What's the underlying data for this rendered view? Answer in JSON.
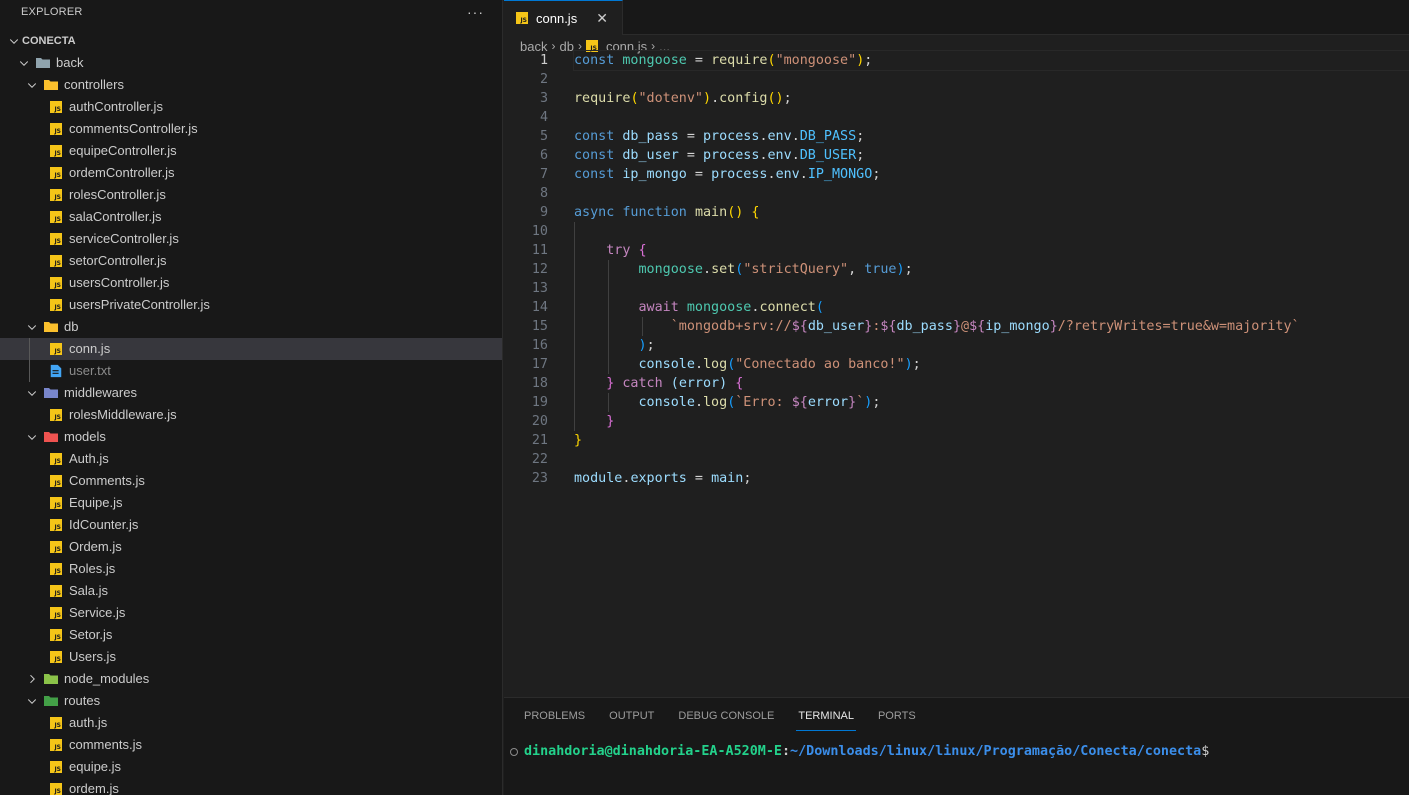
{
  "explorer": {
    "title": "EXPLORER",
    "more_label": "···",
    "root": "CONECTA",
    "tree": [
      {
        "name": "back",
        "type": "folder",
        "depth": 0,
        "expanded": true,
        "icon": "folder-icon",
        "color": "#90a4ae"
      },
      {
        "name": "controllers",
        "type": "folder",
        "depth": 1,
        "expanded": true,
        "icon": "folder-controllers-icon",
        "color": "#fbc02d"
      },
      {
        "name": "authController.js",
        "type": "js",
        "depth": 2
      },
      {
        "name": "commentsController.js",
        "type": "js",
        "depth": 2
      },
      {
        "name": "equipeController.js",
        "type": "js",
        "depth": 2
      },
      {
        "name": "ordemController.js",
        "type": "js",
        "depth": 2
      },
      {
        "name": "rolesController.js",
        "type": "js",
        "depth": 2
      },
      {
        "name": "salaController.js",
        "type": "js",
        "depth": 2
      },
      {
        "name": "serviceController.js",
        "type": "js",
        "depth": 2
      },
      {
        "name": "setorController.js",
        "type": "js",
        "depth": 2
      },
      {
        "name": "usersController.js",
        "type": "js",
        "depth": 2
      },
      {
        "name": "usersPrivateController.js",
        "type": "js",
        "depth": 2
      },
      {
        "name": "db",
        "type": "folder",
        "depth": 1,
        "expanded": true,
        "icon": "folder-database-icon",
        "color": "#fbc02d"
      },
      {
        "name": "conn.js",
        "type": "js",
        "depth": 2,
        "selected": true
      },
      {
        "name": "user.txt",
        "type": "txt",
        "depth": 2,
        "dim": true
      },
      {
        "name": "middlewares",
        "type": "folder",
        "depth": 1,
        "expanded": true,
        "icon": "folder-middleware-icon",
        "color": "#7986cb"
      },
      {
        "name": "rolesMiddleware.js",
        "type": "js",
        "depth": 2
      },
      {
        "name": "models",
        "type": "folder",
        "depth": 1,
        "expanded": true,
        "icon": "folder-models-icon",
        "color": "#ef5350"
      },
      {
        "name": "Auth.js",
        "type": "js",
        "depth": 2
      },
      {
        "name": "Comments.js",
        "type": "js",
        "depth": 2
      },
      {
        "name": "Equipe.js",
        "type": "js",
        "depth": 2
      },
      {
        "name": "IdCounter.js",
        "type": "js",
        "depth": 2
      },
      {
        "name": "Ordem.js",
        "type": "js",
        "depth": 2
      },
      {
        "name": "Roles.js",
        "type": "js",
        "depth": 2
      },
      {
        "name": "Sala.js",
        "type": "js",
        "depth": 2
      },
      {
        "name": "Service.js",
        "type": "js",
        "depth": 2
      },
      {
        "name": "Setor.js",
        "type": "js",
        "depth": 2
      },
      {
        "name": "Users.js",
        "type": "js",
        "depth": 2
      },
      {
        "name": "node_modules",
        "type": "folder",
        "depth": 1,
        "expanded": false,
        "icon": "folder-node-icon",
        "color": "#8bc34a"
      },
      {
        "name": "routes",
        "type": "folder",
        "depth": 1,
        "expanded": true,
        "icon": "folder-routes-icon",
        "color": "#43a047"
      },
      {
        "name": "auth.js",
        "type": "js",
        "depth": 2
      },
      {
        "name": "comments.js",
        "type": "js",
        "depth": 2
      },
      {
        "name": "equipe.js",
        "type": "js",
        "depth": 2
      },
      {
        "name": "ordem.js",
        "type": "js",
        "depth": 2
      }
    ]
  },
  "editor": {
    "tab": {
      "label": "conn.js",
      "close": "✕",
      "icon_text": "JS"
    },
    "breadcrumb": [
      "back",
      "db",
      "conn.js",
      "..."
    ],
    "active_line": 1,
    "lines": [
      [
        [
          "k",
          "const "
        ],
        [
          "v",
          "mongoose"
        ],
        [
          "o",
          " = "
        ],
        [
          "f",
          "require"
        ],
        [
          "p1",
          "("
        ],
        [
          "s",
          "\"mongoose\""
        ],
        [
          "p1",
          ")"
        ],
        [
          "o",
          ";"
        ]
      ],
      [],
      [
        [
          "f",
          "require"
        ],
        [
          "p1",
          "("
        ],
        [
          "s",
          "\"dotenv\""
        ],
        [
          "p1",
          ")"
        ],
        [
          "o",
          "."
        ],
        [
          "f",
          "config"
        ],
        [
          "p1",
          "()"
        ],
        [
          "o",
          ";"
        ]
      ],
      [],
      [
        [
          "k",
          "const "
        ],
        [
          "vb",
          "db_pass"
        ],
        [
          "o",
          " = "
        ],
        [
          "vb",
          "process"
        ],
        [
          "o",
          "."
        ],
        [
          "vb",
          "env"
        ],
        [
          "o",
          "."
        ],
        [
          "c",
          "DB_PASS"
        ],
        [
          "o",
          ";"
        ]
      ],
      [
        [
          "k",
          "const "
        ],
        [
          "vb",
          "db_user"
        ],
        [
          "o",
          " = "
        ],
        [
          "vb",
          "process"
        ],
        [
          "o",
          "."
        ],
        [
          "vb",
          "env"
        ],
        [
          "o",
          "."
        ],
        [
          "c",
          "DB_USER"
        ],
        [
          "o",
          ";"
        ]
      ],
      [
        [
          "k",
          "const "
        ],
        [
          "vb",
          "ip_mongo"
        ],
        [
          "o",
          " = "
        ],
        [
          "vb",
          "process"
        ],
        [
          "o",
          "."
        ],
        [
          "vb",
          "env"
        ],
        [
          "o",
          "."
        ],
        [
          "c",
          "IP_MONGO"
        ],
        [
          "o",
          ";"
        ]
      ],
      [],
      [
        [
          "k",
          "async "
        ],
        [
          "k",
          "function "
        ],
        [
          "f",
          "main"
        ],
        [
          "p1",
          "()"
        ],
        [
          "o",
          " "
        ],
        [
          "p1",
          "{"
        ]
      ],
      [],
      [
        [
          "o",
          "    "
        ],
        [
          "kc",
          "try "
        ],
        [
          "p2",
          "{"
        ]
      ],
      [
        [
          "o",
          "        "
        ],
        [
          "v",
          "mongoose"
        ],
        [
          "o",
          "."
        ],
        [
          "f",
          "set"
        ],
        [
          "p3",
          "("
        ],
        [
          "s",
          "\"strictQuery\""
        ],
        [
          "o",
          ", "
        ],
        [
          "k",
          "true"
        ],
        [
          "p3",
          ")"
        ],
        [
          "o",
          ";"
        ]
      ],
      [],
      [
        [
          "o",
          "        "
        ],
        [
          "kc",
          "await "
        ],
        [
          "v",
          "mongoose"
        ],
        [
          "o",
          "."
        ],
        [
          "f",
          "connect"
        ],
        [
          "p3",
          "("
        ]
      ],
      [
        [
          "o",
          "            "
        ],
        [
          "s",
          "`mongodb+srv://"
        ],
        [
          "kc",
          "${"
        ],
        [
          "vb",
          "db_user"
        ],
        [
          "kc",
          "}"
        ],
        [
          "s",
          ":"
        ],
        [
          "kc",
          "${"
        ],
        [
          "vb",
          "db_pass"
        ],
        [
          "kc",
          "}"
        ],
        [
          "s",
          "@"
        ],
        [
          "kc",
          "${"
        ],
        [
          "vb",
          "ip_mongo"
        ],
        [
          "kc",
          "}"
        ],
        [
          "s",
          "/?retryWrites=true&w=majority`"
        ]
      ],
      [
        [
          "o",
          "        "
        ],
        [
          "p3",
          ")"
        ],
        [
          "o",
          ";"
        ]
      ],
      [
        [
          "o",
          "        "
        ],
        [
          "vb",
          "console"
        ],
        [
          "o",
          "."
        ],
        [
          "f",
          "log"
        ],
        [
          "p3",
          "("
        ],
        [
          "s",
          "\"Conectado ao banco!\""
        ],
        [
          "p3",
          ")"
        ],
        [
          "o",
          ";"
        ]
      ],
      [
        [
          "o",
          "    "
        ],
        [
          "p2",
          "}"
        ],
        [
          "kc",
          " catch "
        ],
        [
          "vb",
          "("
        ],
        [
          "vb",
          "error"
        ],
        [
          "vb",
          ")"
        ],
        [
          "o",
          " "
        ],
        [
          "p2",
          "{"
        ]
      ],
      [
        [
          "o",
          "        "
        ],
        [
          "vb",
          "console"
        ],
        [
          "o",
          "."
        ],
        [
          "f",
          "log"
        ],
        [
          "p3",
          "("
        ],
        [
          "s",
          "`Erro: "
        ],
        [
          "kc",
          "${"
        ],
        [
          "vb",
          "error"
        ],
        [
          "kc",
          "}"
        ],
        [
          "s",
          "`"
        ],
        [
          "p3",
          ")"
        ],
        [
          "o",
          ";"
        ]
      ],
      [
        [
          "o",
          "    "
        ],
        [
          "p2",
          "}"
        ]
      ],
      [
        [
          "p1",
          "}"
        ]
      ],
      [],
      [
        [
          "vb",
          "module"
        ],
        [
          "o",
          "."
        ],
        [
          "vb",
          "exports"
        ],
        [
          "o",
          " = "
        ],
        [
          "vb",
          "main"
        ],
        [
          "o",
          ";"
        ]
      ]
    ]
  },
  "panel": {
    "tabs": [
      "PROBLEMS",
      "OUTPUT",
      "DEBUG CONSOLE",
      "TERMINAL",
      "PORTS"
    ],
    "active_tab": "TERMINAL",
    "terminal": {
      "user_host": "dinahdoria@dinahdoria-EA-A520M-E",
      "separator": ":",
      "path": "~/Downloads/linux/linux/Programação/Conecta/conecta",
      "prompt": "$"
    }
  },
  "colors": {
    "accent": "#0078d4",
    "js_icon": "#f5c518",
    "txt_icon": "#42a5f5",
    "terminal_user": "#23d18b",
    "terminal_path": "#3b8eea"
  }
}
